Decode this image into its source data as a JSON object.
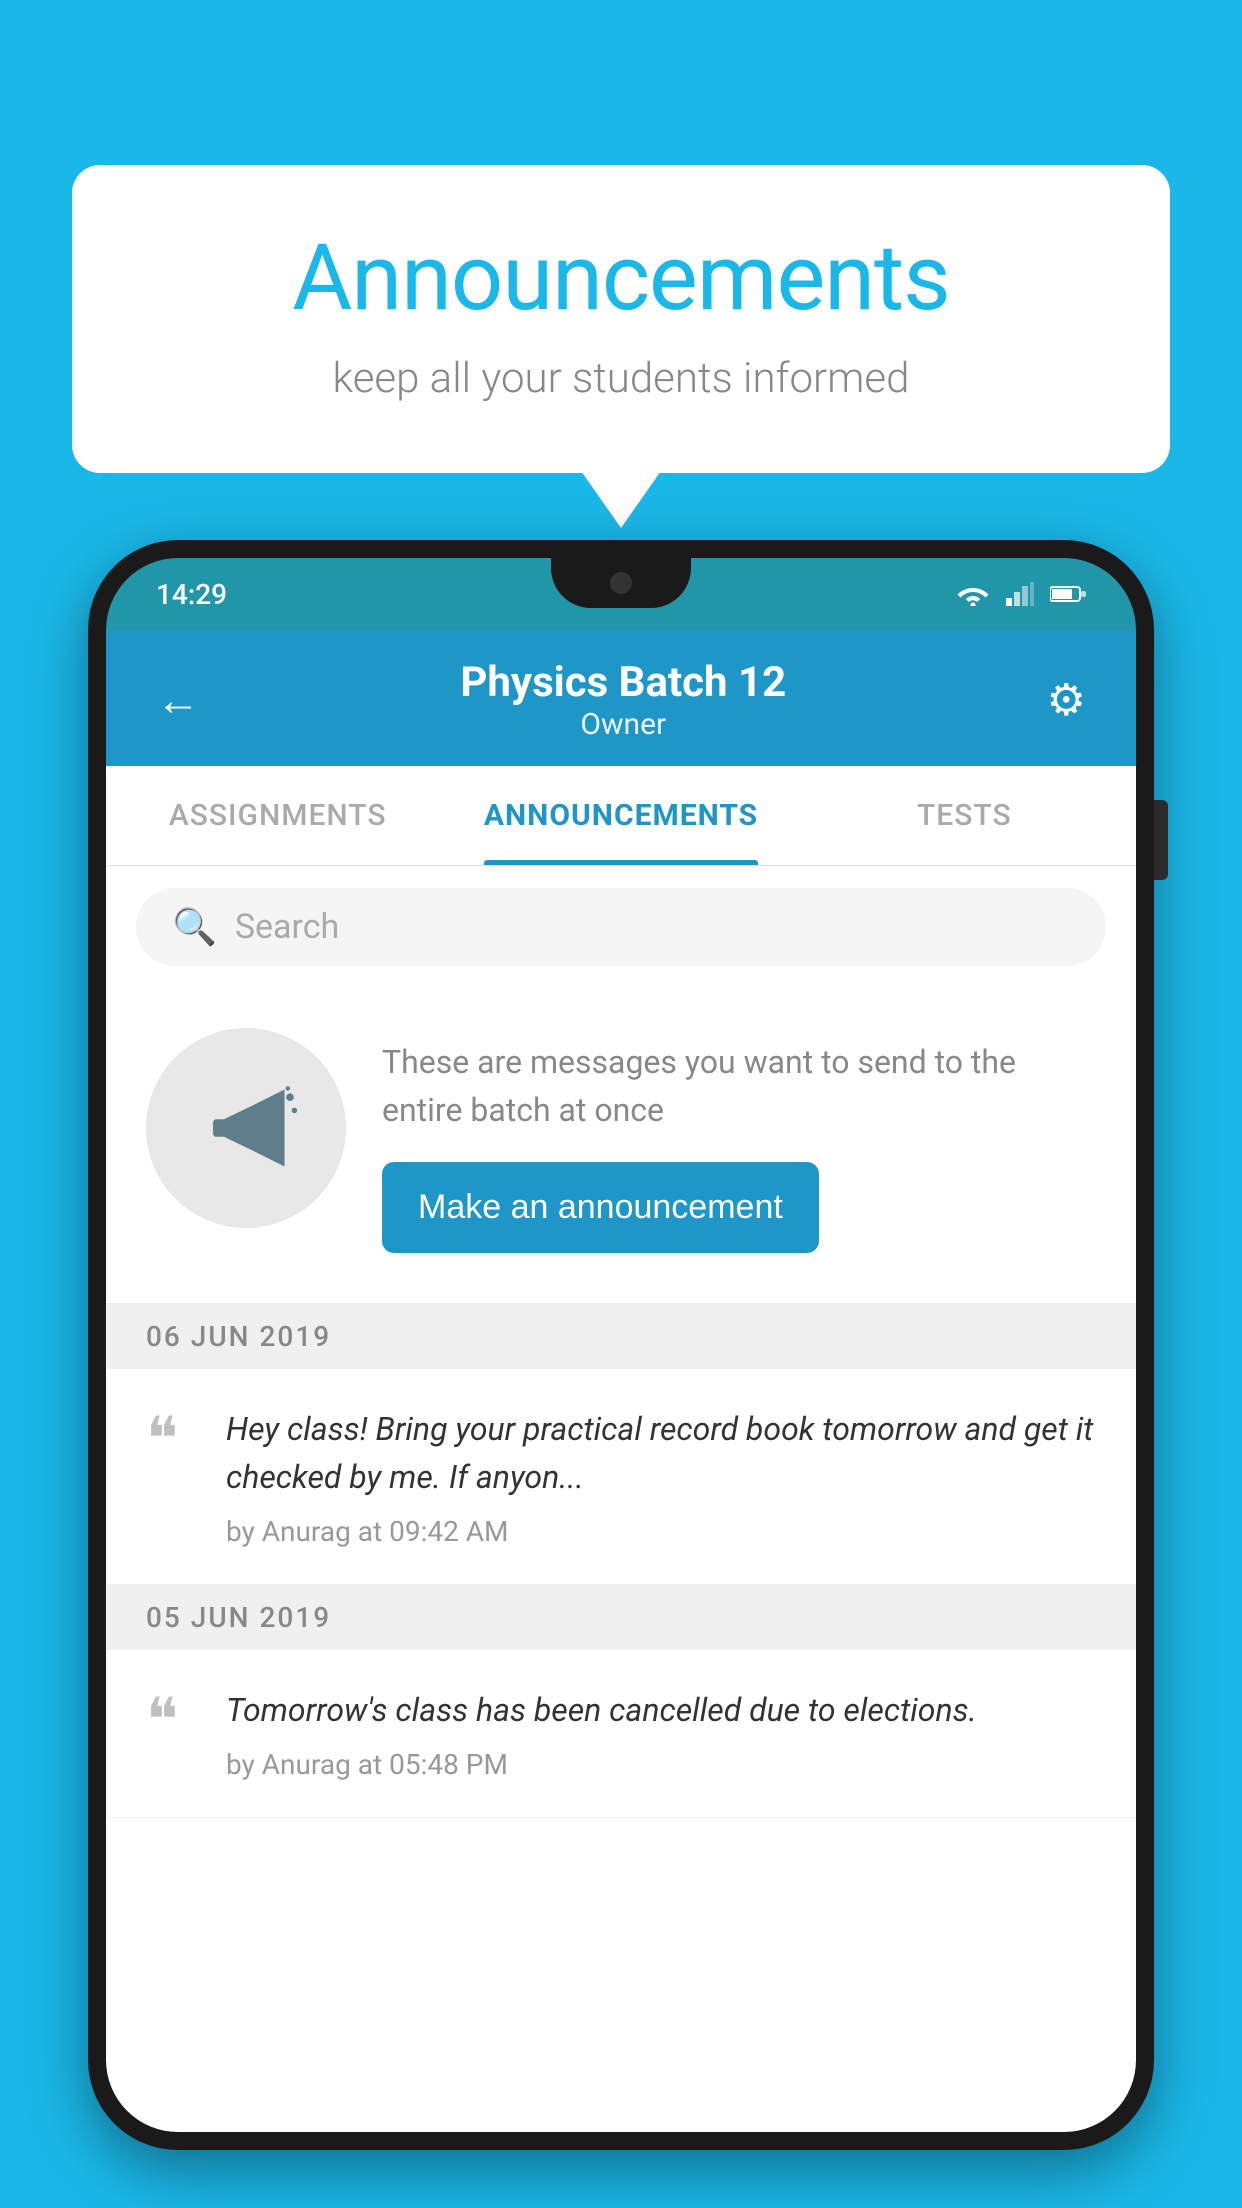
{
  "background_color": "#1ab8e8",
  "speech_bubble": {
    "title": "Announcements",
    "subtitle": "keep all your students informed"
  },
  "phone": {
    "status_bar": {
      "time": "14:29"
    },
    "header": {
      "title": "Physics Batch 12",
      "subtitle": "Owner",
      "back_label": "←",
      "gear_label": "⚙"
    },
    "tabs": [
      {
        "label": "ASSIGNMENTS",
        "active": false
      },
      {
        "label": "ANNOUNCEMENTS",
        "active": true
      },
      {
        "label": "TESTS",
        "active": false
      }
    ],
    "search": {
      "placeholder": "Search"
    },
    "promo": {
      "description_text": "These are messages you want to send to the entire batch at once",
      "button_label": "Make an announcement"
    },
    "announcements": [
      {
        "date": "06  JUN  2019",
        "items": [
          {
            "text": "Hey class! Bring your practical record book tomorrow and get it checked by me. If anyon...",
            "meta": "by Anurag at 09:42 AM"
          }
        ]
      },
      {
        "date": "05  JUN  2019",
        "items": [
          {
            "text": "Tomorrow's class has been cancelled due to elections.",
            "meta": "by Anurag at 05:48 PM"
          }
        ]
      }
    ]
  }
}
